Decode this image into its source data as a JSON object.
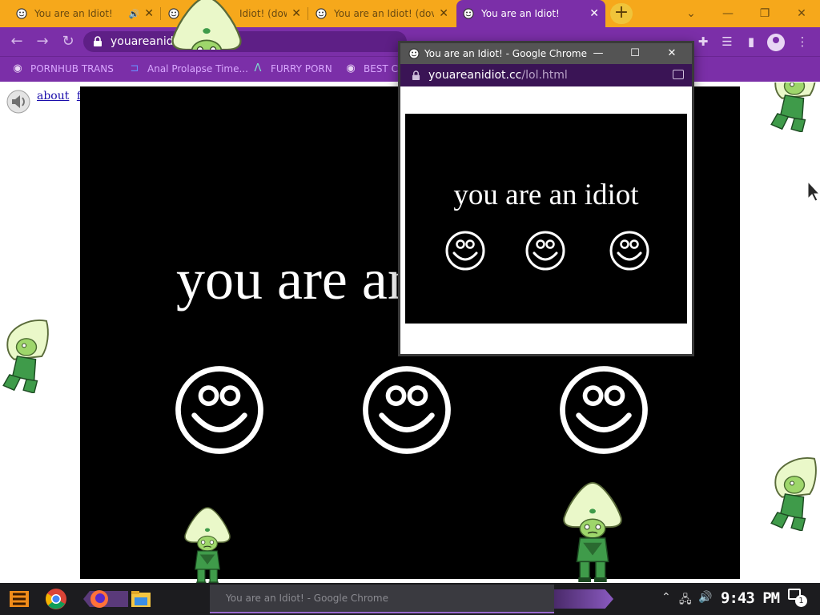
{
  "browser": {
    "tabs": [
      {
        "title": "You are an Idiot!",
        "audible": true
      },
      {
        "title": "Idiot! (dow",
        "audible": false
      },
      {
        "title": "You are an Idiot! (dov",
        "audible": false
      },
      {
        "title": "You are an Idiot!",
        "audible": false,
        "active": true
      }
    ],
    "new_tab_label": "+",
    "omnibox_url": "youareanidiot.cc",
    "window_controls": {
      "minimize": "—",
      "restore": "❐",
      "close": "✕"
    }
  },
  "bookmarks": [
    {
      "label": "PORNHUB TRANS",
      "icon": "globe-icon"
    },
    {
      "label": "Anal Prolapse Time...",
      "icon": "bracket-icon"
    },
    {
      "label": "FURRY PORN",
      "icon": "lambda-icon"
    },
    {
      "label": "BEST C",
      "icon": "globe-icon"
    }
  ],
  "page": {
    "links": [
      "about",
      "flash"
    ],
    "big_title": "you are an idiot"
  },
  "popup": {
    "title": "You are an Idiot! - Google Chrome",
    "url_host": "youareanidiot.cc",
    "url_path": "/lol.html",
    "heading": "you are an idiot"
  },
  "taskbar": {
    "clock": "9:43 PM",
    "notification_count": "1"
  },
  "colors": {
    "tab_strip": "#f6a81b",
    "toolbar": "#7b2fa8",
    "stage_background": "#000000",
    "gem_skin": "#d8f5a8",
    "gem_suit": "#3f9b4a"
  }
}
